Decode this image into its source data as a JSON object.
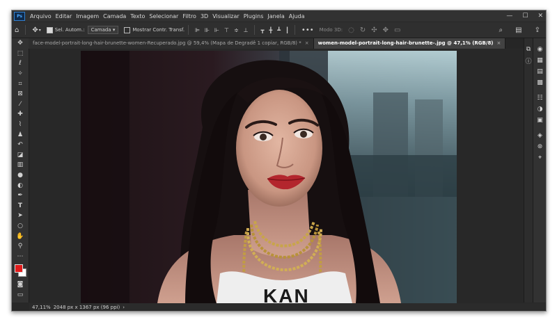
{
  "menubar": {
    "logo": "Ps",
    "items": [
      "Arquivo",
      "Editar",
      "Imagem",
      "Camada",
      "Texto",
      "Selecionar",
      "Filtro",
      "3D",
      "Visualizar",
      "Plugins",
      "Janela",
      "Ajuda"
    ]
  },
  "window_controls": {
    "minimize": "—",
    "maximize": "☐",
    "close": "✕"
  },
  "options": {
    "auto_select_label": "Sel. Autom.:",
    "auto_select_checked": true,
    "target": "Camada",
    "transform_label": "Mostrar Contr. Transf.",
    "transform_checked": false,
    "more": "•••",
    "mode_3d_label": "Modo 3D:"
  },
  "tabs": [
    {
      "label": "face-model-portrait-long-hair-brunette-women-Recuperado.jpg @ 59,4% (Mapa de Degradê 1 copiar, RGB/8) *",
      "active": false,
      "close": "×"
    },
    {
      "label": "women-model-portrait-long-hair-brunette-.jpg @ 47,1% (RGB/8)",
      "active": true,
      "close": "×"
    }
  ],
  "tools": [
    "move-tool-icon",
    "marquee-tool-icon",
    "lasso-tool-icon",
    "magic-wand-icon",
    "crop-tool-icon",
    "frame-tool-icon",
    "eyedropper-icon",
    "healing-brush-icon",
    "brush-tool-icon",
    "clone-stamp-icon",
    "history-brush-icon",
    "eraser-icon",
    "gradient-tool-icon",
    "blur-tool-icon",
    "dodge-tool-icon",
    "pen-tool-icon",
    "type-tool-icon",
    "path-selection-icon",
    "ellipse-tool-icon",
    "hand-tool-icon",
    "zoom-tool-icon",
    "more-tools-icon"
  ],
  "colors": {
    "foreground": "#e01b1b",
    "background": "#ffffff"
  },
  "statusbar": {
    "zoom": "47,11%",
    "doc_info": "2048 px x 1367 px (96 ppi)",
    "arrow": "›"
  },
  "canvas": {
    "shirt_text": "KAN"
  }
}
